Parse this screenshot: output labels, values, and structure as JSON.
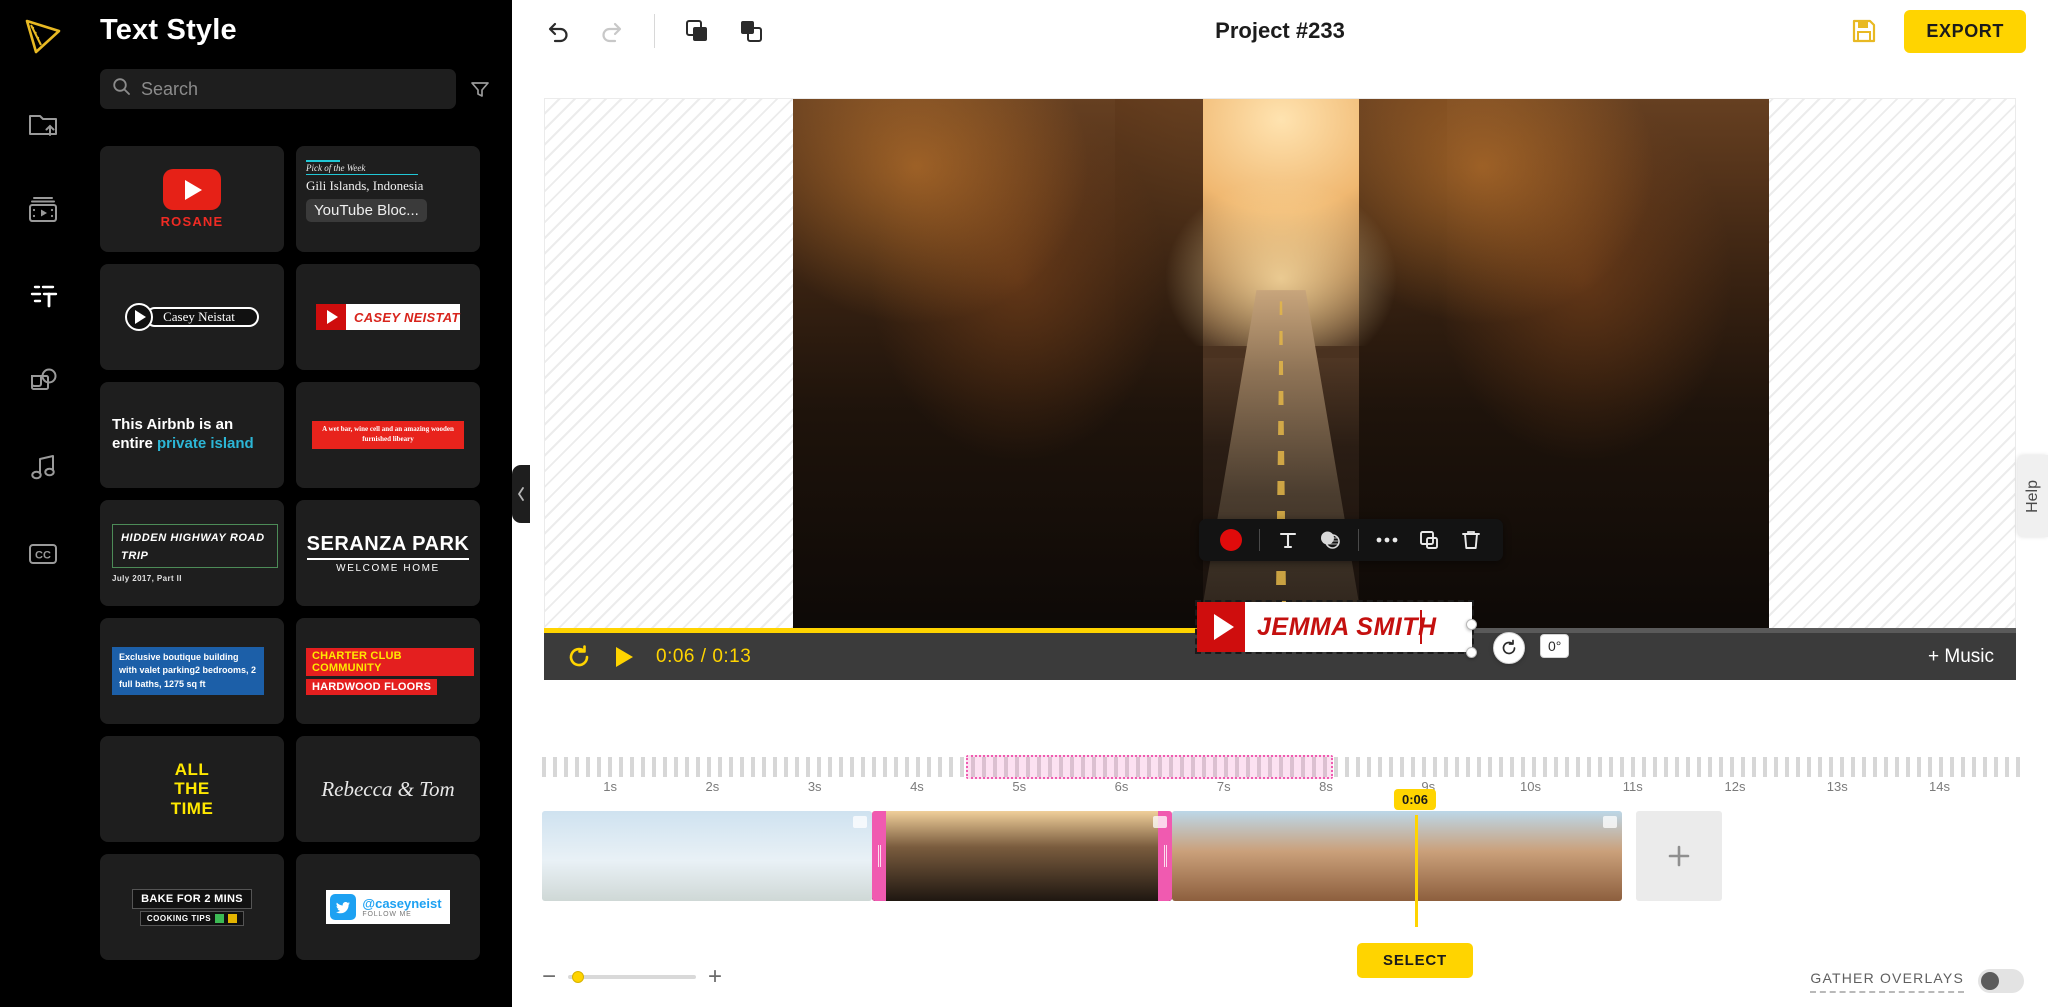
{
  "rail": {
    "logo_icon": "film-play-logo",
    "items": [
      {
        "icon": "upload-folder-icon",
        "name": "upload",
        "active": false
      },
      {
        "icon": "media-filmstrip-icon",
        "name": "media",
        "active": false
      },
      {
        "icon": "text-style-icon",
        "name": "text",
        "active": true
      },
      {
        "icon": "shapes-icon",
        "name": "elements",
        "active": false
      },
      {
        "icon": "music-note-icon",
        "name": "audio",
        "active": false
      },
      {
        "icon": "closed-caption-icon",
        "name": "captions",
        "active": false
      }
    ]
  },
  "panel": {
    "title": "Text Style",
    "search": {
      "placeholder": "Search",
      "value": ""
    },
    "filter_icon": "filter-funnel-icon",
    "cards": [
      {
        "id": "rosane",
        "kind": "yt-logo",
        "name": "ROSANE"
      },
      {
        "id": "youtube-block",
        "kind": "pick",
        "kicker": "Pick of the Week",
        "place": "Gili Islands, Indonesia",
        "chip": "YouTube Bloc..."
      },
      {
        "id": "casey-pill",
        "kind": "pill",
        "name": "Casey Neistat"
      },
      {
        "id": "casey-bar",
        "kind": "redbar",
        "name": "CASEY NEISTAT"
      },
      {
        "id": "airbnb",
        "kind": "headline",
        "line1": "This Airbnb is an",
        "line2_pre": "entire ",
        "line2_hl": "private island"
      },
      {
        "id": "wetbar",
        "kind": "redblock",
        "text": "A wet bar, wine cell and an amazing wooden furnished libeary"
      },
      {
        "id": "hidden-hwy",
        "kind": "boxed",
        "title": "HIDDEN HIGHWAY ROAD TRIP",
        "sub": "July 2017, Part II"
      },
      {
        "id": "seranza",
        "kind": "park",
        "title": "SERANZA PARK",
        "sub": "WELCOME HOME"
      },
      {
        "id": "boutique",
        "kind": "blueblock",
        "text": "Exclusive boutique building with valet parking2 bedrooms, 2 full baths, 1275 sq ft"
      },
      {
        "id": "charter",
        "kind": "twobars",
        "bar1": "CHARTER CLUB COMMUNITY",
        "bar2": "HARDWOOD FLOORS"
      },
      {
        "id": "allthetime",
        "kind": "yellow",
        "line1": "ALL",
        "line2": "THE",
        "line3": "TIME"
      },
      {
        "id": "rebecca-tom",
        "kind": "script",
        "text": "Rebecca & Tom"
      },
      {
        "id": "bake",
        "kind": "cooking",
        "title": "BAKE FOR 2 MINS",
        "sub": "COOKING TIPS"
      },
      {
        "id": "twitter",
        "kind": "twitter",
        "handle": "@caseyneist",
        "sub": "FOLLOW ME"
      }
    ]
  },
  "collapse_icon": "chevron-left-icon",
  "topbar": {
    "undo_icon": "undo-icon",
    "redo_icon": "redo-icon",
    "duplicate_icon": "duplicate-layers-icon",
    "group_icon": "group-layers-icon",
    "title": "Project #233",
    "save_icon": "save-disk-icon",
    "export_label": "EXPORT"
  },
  "preview": {
    "tools": [
      {
        "icon": "color-swatch-icon",
        "name": "text-color",
        "color": "#e00b0b"
      },
      {
        "icon": "text-format-icon",
        "name": "font-style"
      },
      {
        "icon": "opacity-icon",
        "name": "opacity"
      },
      {
        "icon": "more-options-icon",
        "name": "more"
      },
      {
        "icon": "duplicate-icon",
        "name": "duplicate"
      },
      {
        "icon": "trash-icon",
        "name": "delete"
      }
    ],
    "overlay": {
      "text": "JEMMA SMITH",
      "play_icon": "play-triangle-icon"
    },
    "rotation": {
      "icon": "rotate-icon",
      "angle": "0°"
    }
  },
  "playbar": {
    "loop_icon": "loop-icon",
    "play_icon": "play-icon",
    "current_time": "0:06",
    "separator": "/",
    "total_time": "0:13",
    "music_label": "+ Music",
    "progress_percent": 46
  },
  "timeline": {
    "ruler_labels": [
      "1s",
      "2s",
      "3s",
      "4s",
      "5s",
      "6s",
      "7s",
      "8s",
      "9s",
      "10s",
      "11s",
      "12s",
      "13s",
      "14s"
    ],
    "playhead_time": "0:06",
    "select_label": "SELECT",
    "add_icon": "plus-icon",
    "zoom": {
      "minus": "−",
      "plus": "+",
      "value": 8
    },
    "overlays_label": "GATHER OVERLAYS",
    "overlays_on": false,
    "clips": [
      {
        "name": "clip-beach",
        "selected": false
      },
      {
        "name": "clip-forest-road",
        "selected": true
      },
      {
        "name": "clip-canyon",
        "selected": false
      }
    ]
  },
  "help": {
    "label": "Help"
  },
  "colors": {
    "accent_yellow": "#ffd400",
    "selection_pink": "#f05ab0",
    "brand_red": "#e62117",
    "panel_black": "#000000"
  }
}
